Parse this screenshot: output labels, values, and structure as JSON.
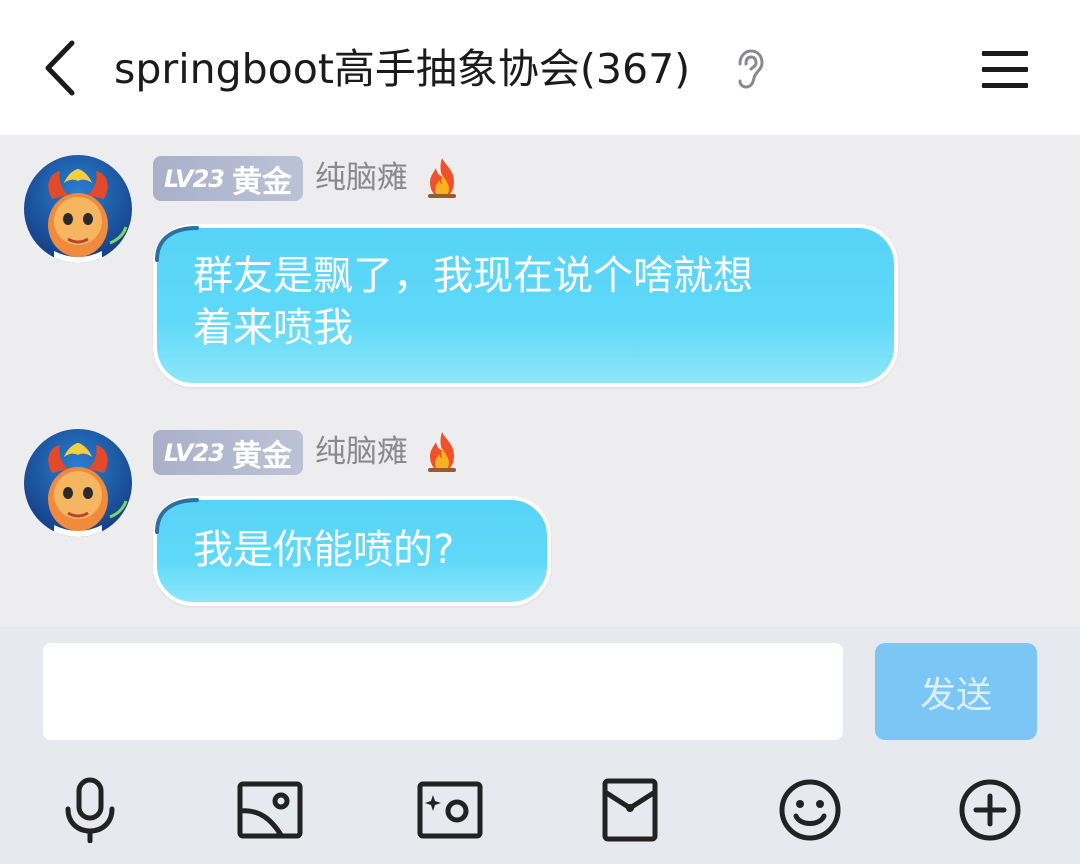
{
  "header": {
    "title": "springboot高手抽象协会(367)",
    "back_icon": "chevron-left-icon",
    "ear_icon": "ear-icon",
    "menu_icon": "hamburger-menu-icon"
  },
  "messages": [
    {
      "level": "LV23",
      "tier": "黄金",
      "nickname": "纯脑瘫",
      "fire_icon": "fire-icon",
      "lines": [
        "群友是飘了，我现在说个啥就想",
        "着来喷我"
      ]
    },
    {
      "level": "LV23",
      "tier": "黄金",
      "nickname": "纯脑瘫",
      "fire_icon": "fire-icon",
      "lines": [
        "我是你能喷的?"
      ]
    }
  ],
  "input": {
    "value": "",
    "send_label": "发送"
  },
  "toolbar": [
    "microphone-icon",
    "image-icon",
    "camera-icon",
    "red-packet-icon",
    "emoji-icon",
    "plus-icon"
  ],
  "colors": {
    "bubble": "#5fd9f8",
    "badge": "#b0b6cc",
    "send_button": "#7cc6f6"
  }
}
